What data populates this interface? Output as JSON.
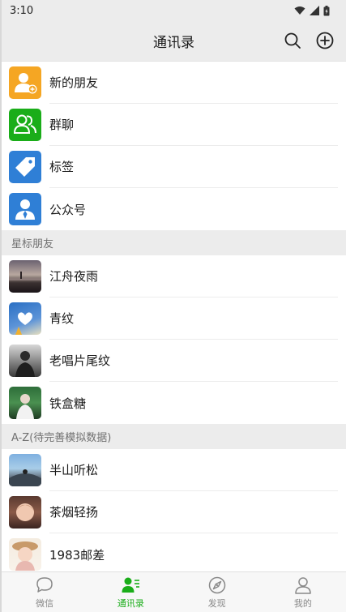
{
  "status_bar": {
    "time": "3:10"
  },
  "header": {
    "title": "通讯录"
  },
  "functions": [
    {
      "label": "新的朋友",
      "icon": "add-friend-icon",
      "color": "#f5a623"
    },
    {
      "label": "群聊",
      "icon": "group-chat-icon",
      "color": "#1aad19"
    },
    {
      "label": "标签",
      "icon": "tag-icon",
      "color": "#2f7fd6"
    },
    {
      "label": "公众号",
      "icon": "official-account-icon",
      "color": "#2f7fd6"
    }
  ],
  "sections": {
    "starred_title": "星标朋友",
    "starred": [
      {
        "name": "江舟夜雨"
      },
      {
        "name": "青纹"
      },
      {
        "name": "老唱片尾纹"
      },
      {
        "name": "铁盒糖"
      }
    ],
    "az_title": "A-Z(待完善模拟数据)",
    "az": [
      {
        "name": "半山听松"
      },
      {
        "name": "茶烟轻扬"
      },
      {
        "name": "1983邮差"
      }
    ]
  },
  "tabs": [
    {
      "label": "微信",
      "icon": "chat-icon",
      "active": false
    },
    {
      "label": "通讯录",
      "icon": "contacts-icon",
      "active": true
    },
    {
      "label": "发现",
      "icon": "compass-icon",
      "active": false
    },
    {
      "label": "我的",
      "icon": "profile-icon",
      "active": false
    }
  ],
  "colors": {
    "accent": "#1aad19",
    "inactive": "#888888"
  }
}
